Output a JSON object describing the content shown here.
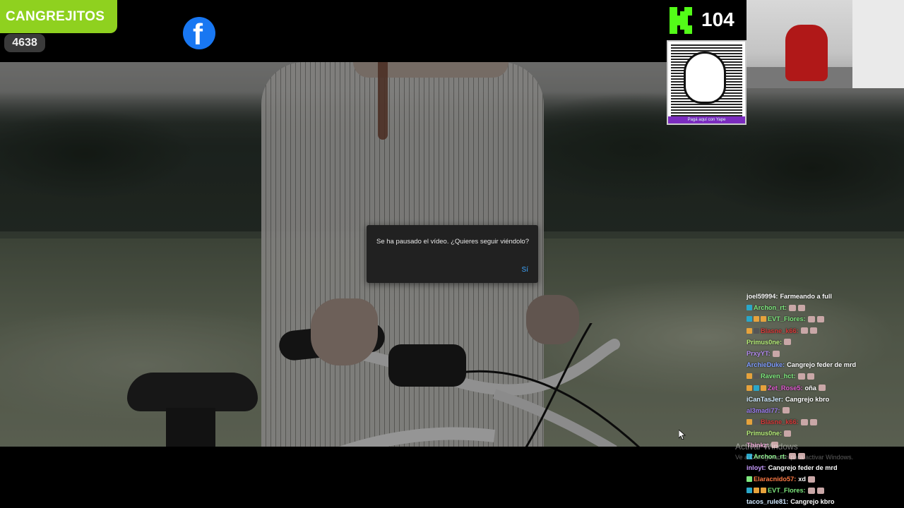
{
  "overlay": {
    "channel_badge": "CANGREJITOS",
    "viewer_count": "4638",
    "kick_count": "104",
    "qr_caption": "Pagá aquí con Yape",
    "colors": {
      "badge": "#8fd11f",
      "kick": "#53fc18",
      "facebook": "#1877f2"
    }
  },
  "dialog": {
    "message": "Se ha pausado el vídeo. ¿Quieres seguir viéndolo?",
    "confirm_label": "Sí"
  },
  "chat": [
    {
      "user": "joel59994:",
      "text": "Farmeando a full",
      "color": "#ffffff",
      "icons": []
    },
    {
      "user": "Archon_rt:",
      "text": "",
      "color": "#7ee87e",
      "icons": [
        "#2aa7c9"
      ],
      "emotes": 2
    },
    {
      "user": "EVT_Flores:",
      "text": "",
      "color": "#7ee87e",
      "icons": [
        "#2aa7c9",
        "#e6a23c",
        "#e6a23c"
      ],
      "emotes": 2
    },
    {
      "user": "Blasne_k66:",
      "text": "",
      "color": "#d63a3a",
      "icons": [
        "#e6a23c",
        "#555"
      ],
      "emotes": 2
    },
    {
      "user": "Primus0ne:",
      "text": "",
      "color": "#b8f07a",
      "icons": [],
      "emotes": 1
    },
    {
      "user": "PrxyYT:",
      "text": "",
      "color": "#b48cf0",
      "icons": [],
      "emotes": 1
    },
    {
      "user": "ArchieDuke:",
      "text": "Cangrejo feder de mrd",
      "color": "#7f9cff",
      "icons": []
    },
    {
      "user": "Raven_hct:",
      "text": "",
      "color": "#7ee87e",
      "icons": [
        "#e6a23c",
        "#555"
      ],
      "emotes": 2
    },
    {
      "user": "Zet_Rose5:",
      "text": "oña",
      "color": "#e05ad0",
      "icons": [
        "#e6a23c",
        "#2aa7c9",
        "#e6a23c"
      ],
      "emotes": 1
    },
    {
      "user": "iCanTasJer:",
      "text": "Cangrejo kbro",
      "color": "#cfe8ff",
      "icons": []
    },
    {
      "user": "al3madi77:",
      "text": "",
      "color": "#9b7cf0",
      "icons": [],
      "emotes": 1
    },
    {
      "user": "Blasne_k66:",
      "text": "",
      "color": "#d63a3a",
      "icons": [
        "#e6a23c",
        "#555"
      ],
      "emotes": 2
    },
    {
      "user": "Primus0ne:",
      "text": "",
      "color": "#b8f07a",
      "icons": [],
      "emotes": 1
    },
    {
      "user": "Thinkz:",
      "text": "",
      "color": "#f0a8d8",
      "icons": [],
      "emotes": 1
    },
    {
      "user": "Archon_rt:",
      "text": "",
      "color": "#7ee87e",
      "icons": [
        "#2aa7c9"
      ],
      "emotes": 2
    },
    {
      "user": "inloyt:",
      "text": "Cangrejo feder de mrd",
      "color": "#c89cff",
      "icons": []
    },
    {
      "user": "Elaracnido57:",
      "text": "xd",
      "color": "#ff7a45",
      "icons": [
        "#7ee87e"
      ],
      "emotes": 1
    },
    {
      "user": "EVT_Flores:",
      "text": "",
      "color": "#7ee87e",
      "icons": [
        "#2aa7c9",
        "#e6a23c",
        "#e6a23c"
      ],
      "emotes": 2
    },
    {
      "user": "tacos_rule81:",
      "text": "Cangrejo kbro",
      "color": "#cfe8ff",
      "icons": []
    }
  ],
  "windows_watermark": {
    "title": "Activar Windows",
    "subtitle": "Ve a Configuración para activar Windows."
  }
}
